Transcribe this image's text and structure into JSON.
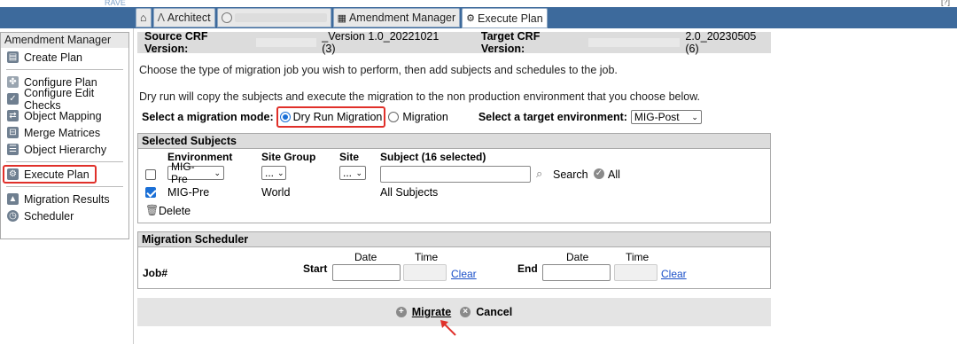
{
  "header": {
    "brand": "RAVE",
    "top_right": "[?]"
  },
  "tabs": [
    {
      "label": ""
    },
    {
      "label": "Architect"
    },
    {
      "label": ""
    },
    {
      "label": "Amendment Manager"
    },
    {
      "label": "Execute Plan"
    }
  ],
  "sidebar": {
    "title": "Amendment Manager",
    "items": [
      {
        "label": "Create Plan",
        "icon": "create-plan-icon"
      },
      {
        "label": "Configure Plan",
        "icon": "wrench-icon"
      },
      {
        "label": "Configure Edit Checks",
        "icon": "edit-checks-icon"
      },
      {
        "label": "Object Mapping",
        "icon": "mapping-icon"
      },
      {
        "label": "Merge Matrices",
        "icon": "merge-icon"
      },
      {
        "label": "Object Hierarchy",
        "icon": "hierarchy-icon"
      },
      {
        "label": "Execute Plan",
        "icon": "execute-icon"
      },
      {
        "label": "Migration Results",
        "icon": "results-icon"
      },
      {
        "label": "Scheduler",
        "icon": "clock-icon"
      }
    ]
  },
  "crf": {
    "source_label": "Source CRF Version:",
    "source_value": "_Version 1.0_20221021 (3)",
    "target_label": "Target CRF Version:",
    "target_value": "2.0_20230505 (6)"
  },
  "instructions": {
    "line1": "Choose the type of migration job you wish to perform, then add subjects and schedules to the job.",
    "line2": "Dry run will copy the subjects and execute the migration to the non production environment that you choose below."
  },
  "mode": {
    "label": "Select a migration mode:",
    "option_dry": "Dry Run Migration",
    "option_migration": "Migration",
    "env_label": "Select a target environment:",
    "env_value": "MIG-Post"
  },
  "subjects": {
    "title": "Selected Subjects",
    "col_env": "Environment",
    "col_sitegroup": "Site Group",
    "col_site": "Site",
    "col_subject": "Subject (16 selected)",
    "filter_env": "MIG-Pre",
    "filter_sitegroup": "...",
    "filter_site": "...",
    "search_label": "Search",
    "all_label": "All",
    "row": {
      "env": "MIG-Pre",
      "sitegroup": "World",
      "subject": "All Subjects"
    },
    "delete_label": "Delete"
  },
  "scheduler": {
    "title": "Migration Scheduler",
    "job_label": "Job#",
    "start_label": "Start",
    "end_label": "End",
    "date_label": "Date",
    "time_label": "Time",
    "clear_label": "Clear"
  },
  "actions": {
    "migrate": "Migrate",
    "cancel": "Cancel"
  }
}
